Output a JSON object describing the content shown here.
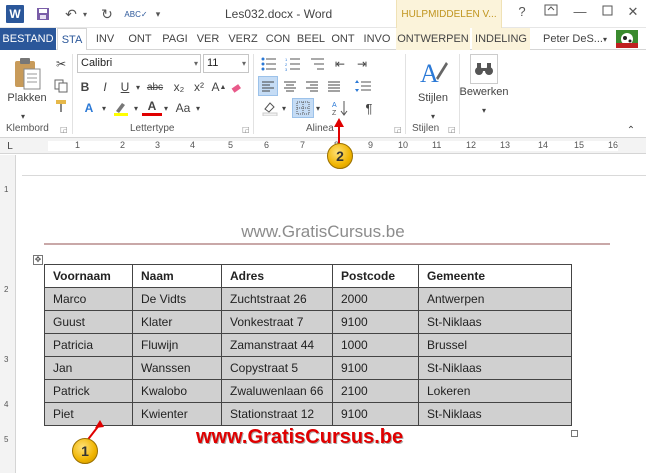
{
  "titlebar": {
    "app_icon": "W",
    "title": "Les032.docx - Word",
    "tools_tab": "HULPMIDDELEN V...",
    "help": "?",
    "minimize": "—",
    "close": "✕"
  },
  "tabs": [
    "BESTAND",
    "STA",
    "INV",
    "ONT",
    "PAGI",
    "VER",
    "VERZ",
    "CON",
    "BEEL",
    "ONT",
    "INVO",
    "ONTWERPEN",
    "INDELING"
  ],
  "user": "Peter DeS...",
  "ribbon": {
    "paste_label": "Plakken",
    "font_name": "Calibri",
    "font_size": "11",
    "styles_label": "Stijlen",
    "edit_label": "Bewerken",
    "groups": [
      "Klembord",
      "Lettertype",
      "Alinea",
      "Stijlen"
    ],
    "font_buttons": [
      "B",
      "I",
      "U",
      "abc",
      "x₂",
      "x²",
      "A",
      "A",
      "Aa"
    ]
  },
  "ruler": [
    "1",
    "2",
    "3",
    "4",
    "5",
    "6",
    "7",
    "8",
    "9",
    "10",
    "11",
    "12",
    "13",
    "14",
    "15",
    "16"
  ],
  "vruler": [
    "1",
    "2",
    "3",
    "4",
    "5"
  ],
  "document": {
    "header_watermark": "www.GratisCursus.be",
    "footer_watermark": "www.GratisCursus.be",
    "table": {
      "headers": [
        "Voornaam",
        "Naam",
        "Adres",
        "Postcode",
        "Gemeente"
      ],
      "rows": [
        [
          "Marco",
          "De Vidts",
          "Zuchtstraat 26",
          "2000",
          "Antwerpen"
        ],
        [
          "Guust",
          "Klater",
          "Vonkestraat  7",
          "9100",
          "St-Niklaas"
        ],
        [
          "Patricia",
          "Fluwijn",
          "Zamanstraat 44",
          "1000",
          "Brussel"
        ],
        [
          "Jan",
          "Wanssen",
          "Copystraat  5",
          "9100",
          "St-Niklaas"
        ],
        [
          "Patrick",
          "Kwalobo",
          "Zwaluwenlaan 66",
          "2100",
          "Lokeren"
        ],
        [
          "Piet",
          "Kwienter",
          "Stationstraat  12",
          "9100",
          "St-Niklaas"
        ]
      ]
    }
  },
  "callouts": [
    "1",
    "2"
  ],
  "colors": {
    "word_blue": "#2b579a",
    "tools_bg": "#fbf3da",
    "callout": "#f0b400",
    "row_fill": "#d0d0d0",
    "footer_red": "#e00000"
  }
}
